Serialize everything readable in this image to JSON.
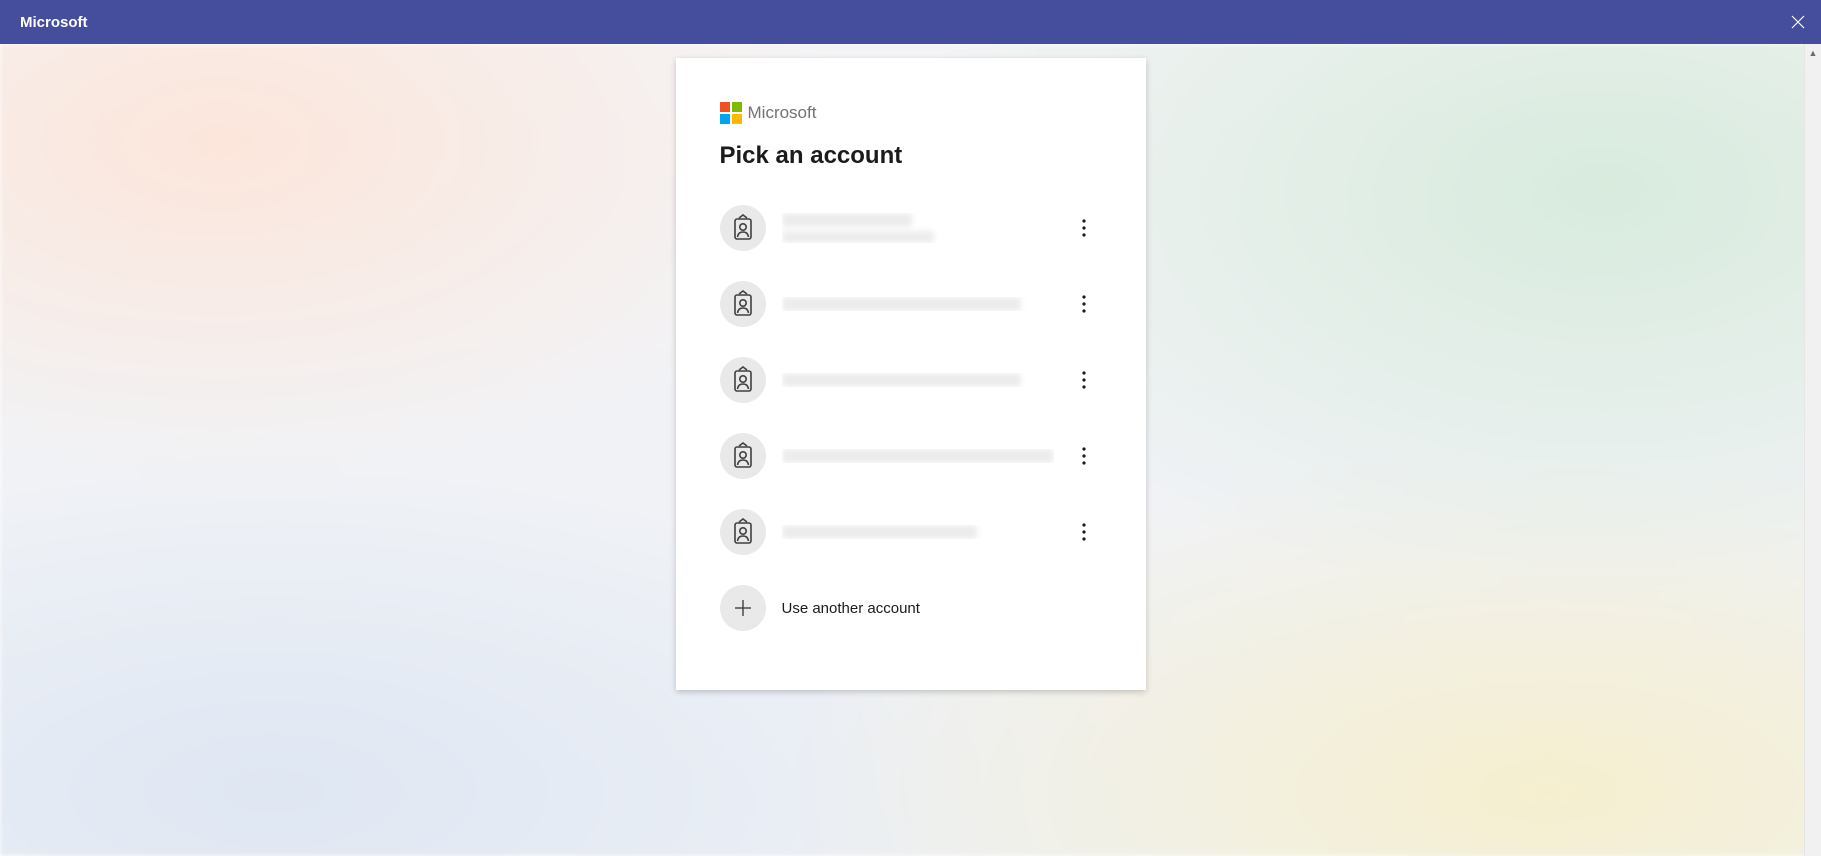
{
  "titlebar": {
    "title": "Microsoft"
  },
  "brand": {
    "name": "Microsoft"
  },
  "heading": "Pick an account",
  "accounts": [
    {
      "primary_redacted": true,
      "secondary_redacted": true,
      "primary_w": "48%",
      "secondary_w": "56%"
    },
    {
      "primary_redacted": true,
      "secondary_redacted": false,
      "primary_w": "88%",
      "secondary_w": "0%"
    },
    {
      "primary_redacted": true,
      "secondary_redacted": false,
      "primary_w": "88%",
      "secondary_w": "0%"
    },
    {
      "primary_redacted": true,
      "secondary_redacted": false,
      "primary_w": "100%",
      "secondary_w": "0%"
    },
    {
      "primary_redacted": true,
      "secondary_redacted": false,
      "primary_w": "72%",
      "secondary_w": "0%"
    }
  ],
  "use_another_label": "Use another account"
}
